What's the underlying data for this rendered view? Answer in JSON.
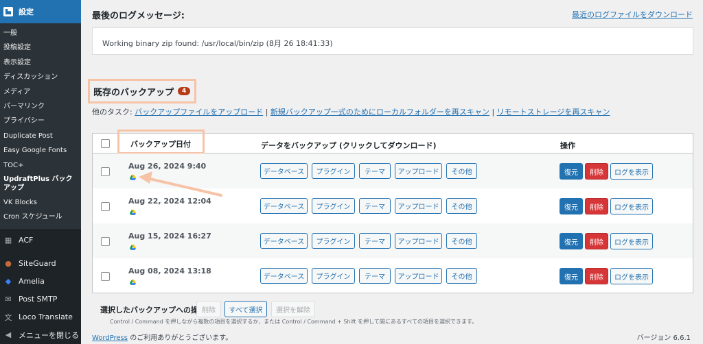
{
  "sidebar": {
    "header": "設定",
    "items": [
      {
        "label": "一般"
      },
      {
        "label": "投稿設定"
      },
      {
        "label": "表示設定"
      },
      {
        "label": "ディスカッション"
      },
      {
        "label": "メディア"
      },
      {
        "label": "パーマリンク"
      },
      {
        "label": "プライバシー"
      },
      {
        "label": "Duplicate Post"
      },
      {
        "label": "Easy Google Fonts"
      },
      {
        "label": "TOC+"
      },
      {
        "label": "UpdraftPlus バックアップ"
      },
      {
        "label": "VK Blocks"
      },
      {
        "label": "Cron スケジュール"
      }
    ],
    "top_items": [
      {
        "label": "ACF"
      },
      {
        "label": "SiteGuard"
      },
      {
        "label": "Amelia"
      },
      {
        "label": "Post SMTP"
      },
      {
        "label": "Loco Translate"
      },
      {
        "label": "メニューを閉じる"
      }
    ]
  },
  "log": {
    "heading": "最後のログメッセージ:",
    "download_link": "最近のログファイルをダウンロード",
    "message": "Working binary zip found: /usr/local/bin/zip (8月 26 18:41:33)"
  },
  "backups": {
    "heading": "既存のバックアップ",
    "count": "4",
    "tasks_label": "他のタスク:",
    "task_upload": "バックアップファイルをアップロード",
    "task_rescan_local": "新規バックアップ一式のためにローカルフォルダーを再スキャン",
    "task_rescan_remote": "リモートストレージを再スキャン",
    "sep": "|",
    "col_date": "バックアップ日付",
    "col_data": "データをバックアップ (クリックしてダウンロード)",
    "col_ops": "操作",
    "data_buttons": [
      "データベース",
      "プラグイン",
      "テーマ",
      "アップロード",
      "その他"
    ],
    "op_restore": "復元",
    "op_delete": "削除",
    "op_log": "ログを表示",
    "rows": [
      {
        "date": "Aug 26, 2024 9:40"
      },
      {
        "date": "Aug 22, 2024 12:04"
      },
      {
        "date": "Aug 15, 2024 16:27"
      },
      {
        "date": "Aug 08, 2024 13:18"
      }
    ]
  },
  "selection": {
    "label": "選択したバックアップへの操作",
    "delete": "削除",
    "select_all": "すべて選択",
    "deselect": "選択を解除",
    "hint": "Control / Command を押しながら複数の項目を選択するか、または Control / Command + Shift を押して間にあるすべての項目を選択できます。"
  },
  "footer": {
    "link": "WordPress",
    "text": " のご利用ありがとうございます。",
    "version": "バージョン 6.6.1"
  },
  "colors": {
    "sidebar_bg": "#1d2327",
    "accent": "#2271b1",
    "danger": "#d63638",
    "highlight": "#f6c3a7"
  }
}
